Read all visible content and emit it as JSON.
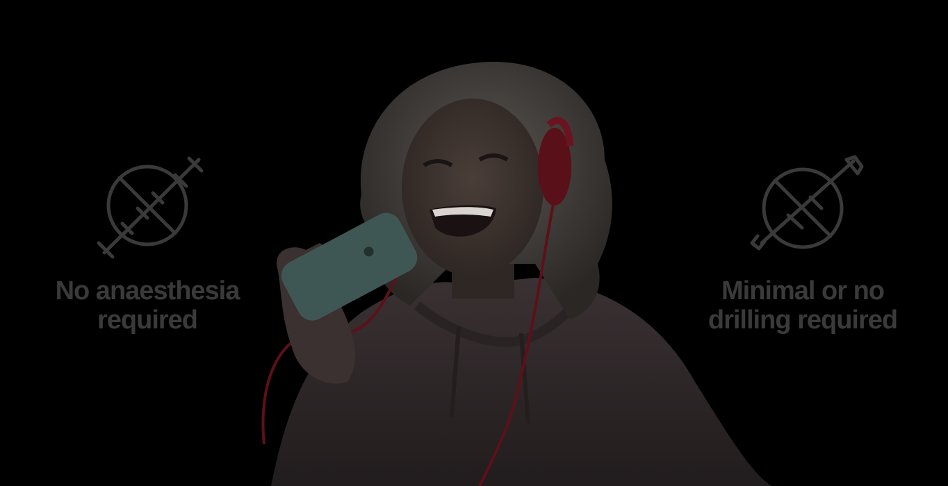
{
  "features": {
    "left": {
      "icon": "no-injection-icon",
      "label_line1": "No anaesthesia",
      "label_line2": "required"
    },
    "right": {
      "icon": "no-drill-icon",
      "label_line1": "Minimal or no",
      "label_line2": "drilling required"
    }
  },
  "colors": {
    "background": "#000000",
    "text": "#3a3a3a",
    "icon_stroke": "#3a3a3a",
    "headphone_red": "#8b1424",
    "phone_teal": "#3f5754",
    "hoodie": "#2e2628"
  }
}
